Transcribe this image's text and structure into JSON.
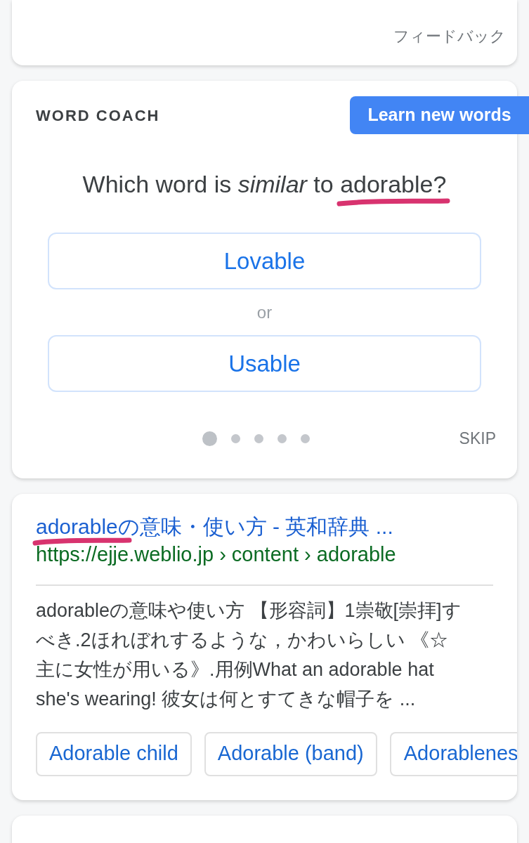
{
  "top_card": {
    "feedback": "フィードバック"
  },
  "word_coach": {
    "heading": "WORD COACH",
    "learn_button": "Learn new words",
    "question": "Which word is *similar* to adorable?",
    "underlined": true,
    "options": [
      "Lovable",
      "Usable"
    ],
    "separator": "or",
    "progress": [
      {
        "selected": true
      },
      {
        "selected": false
      },
      {
        "selected": false
      },
      {
        "selected": false
      },
      {
        "selected": false
      }
    ],
    "skip": "SKIP"
  },
  "result": {
    "title": "adorableの意味・使い方 - 英和辞典 ...",
    "underlined": true,
    "url": "https://ejje.weblio.jp › content › adorable",
    "snippet": "adorableの意味や使い方 【形容詞】1崇敬[崇拝]すべき.2ほれぼれするような，かわいらしい 《☆主に女性が用いる》.用例What an adorable hat she's wearing! 彼女は何とすてきな帽子を ...",
    "chips": [
      "Adorable child",
      "Adorable (band)",
      "Adorablenes"
    ]
  }
}
